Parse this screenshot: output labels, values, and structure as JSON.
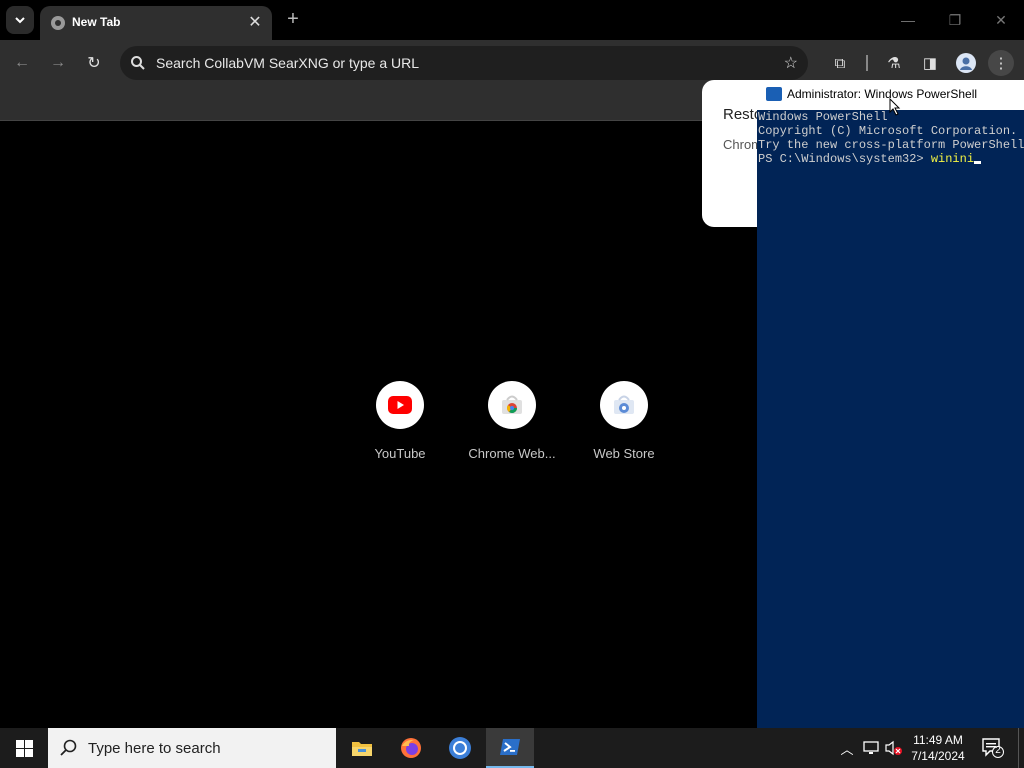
{
  "browser": {
    "tab_title": "New Tab",
    "omnibox_placeholder": "Search CollabVM SearXNG or type a URL",
    "popup": {
      "title": "Resto",
      "text": "Chrom"
    },
    "shortcuts": [
      {
        "label": "YouTube",
        "icon": "youtube-icon"
      },
      {
        "label": "Chrome Web...",
        "icon": "chrome-web-store-icon"
      },
      {
        "label": "Web Store",
        "icon": "web-store-icon"
      }
    ]
  },
  "powershell": {
    "title": "Administrator: Windows PowerShell",
    "lines": [
      "Windows PowerShell",
      "Copyright (C) Microsoft Corporation. A",
      "",
      "Try the new cross-platform PowerShell",
      ""
    ],
    "prompt": "PS C:\\Windows\\system32> ",
    "command": "winini",
    "bg_color": "#012456"
  },
  "taskbar": {
    "search_placeholder": "Type here to search",
    "time": "11:49 AM",
    "date": "7/14/2024",
    "notification_count": "2"
  },
  "colors": {
    "accent": "#76b9ed",
    "youtube_red": "#ff0000"
  }
}
